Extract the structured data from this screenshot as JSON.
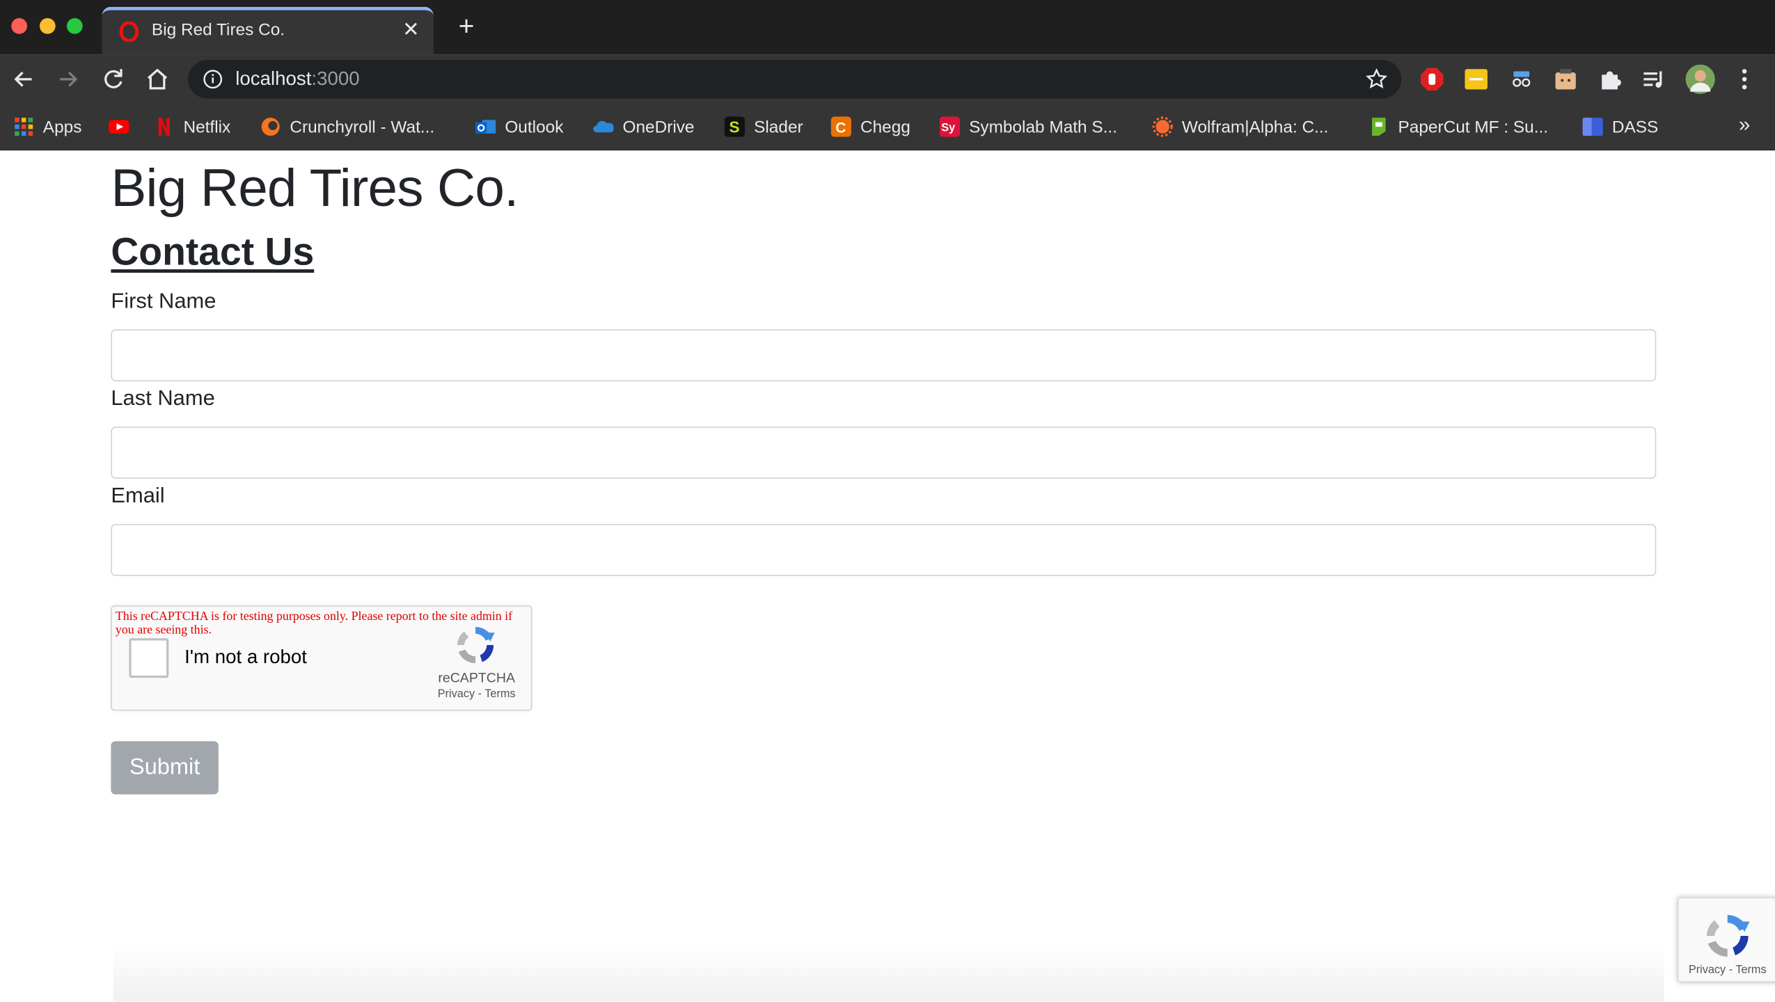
{
  "tab": {
    "title": "Big Red Tires Co.",
    "close_icon": "close-icon",
    "new_tab_icon": "plus-icon"
  },
  "toolbar": {
    "url_host": "localhost",
    "url_port": ":3000"
  },
  "bookmarks": [
    {
      "label": "Apps",
      "icon": "apps-grid-icon",
      "color": "#4285f4"
    },
    {
      "label": "",
      "icon": "youtube-icon",
      "color": "#ff0000"
    },
    {
      "label": "Netflix",
      "icon": "netflix-icon",
      "color": "#e50914"
    },
    {
      "label": "Crunchyroll - Wat...",
      "icon": "crunchyroll-icon",
      "color": "#f47521"
    },
    {
      "label": "Outlook",
      "icon": "outlook-icon",
      "color": "#0a64c8"
    },
    {
      "label": "OneDrive",
      "icon": "onedrive-icon",
      "color": "#2b88d8"
    },
    {
      "label": "Slader",
      "icon": "slader-icon",
      "color": "#b5e61d"
    },
    {
      "label": "Chegg",
      "icon": "chegg-icon",
      "color": "#eb7100"
    },
    {
      "label": "Symbolab Math S...",
      "icon": "symbolab-icon",
      "color": "#dc143c"
    },
    {
      "label": "Wolfram|Alpha: C...",
      "icon": "wolfram-icon",
      "color": "#f96932"
    },
    {
      "label": "PaperCut MF : Su...",
      "icon": "papercut-icon",
      "color": "#6ab42d"
    },
    {
      "label": "DASS",
      "icon": "dass-icon",
      "color": "#3b5fd9"
    }
  ],
  "page": {
    "site_title": "Big Red Tires Co.",
    "section_title": "Contact Us",
    "fields": [
      {
        "label": "First Name",
        "value": "",
        "placeholder": ""
      },
      {
        "label": "Last Name",
        "value": "",
        "placeholder": ""
      },
      {
        "label": "Email",
        "value": "",
        "placeholder": ""
      }
    ],
    "recaptcha": {
      "warning": "This reCAPTCHA is for testing purposes only. Please report to the site admin if you are seeing this.",
      "label": "I'm not a robot",
      "brand": "reCAPTCHA",
      "links": "Privacy - Terms"
    },
    "submit_label": "Submit",
    "badge_links": "Privacy - Terms"
  },
  "colors": {
    "accent": "#8ab4f8",
    "submit_bg": "#a1a7ad",
    "warning": "#e00000"
  }
}
